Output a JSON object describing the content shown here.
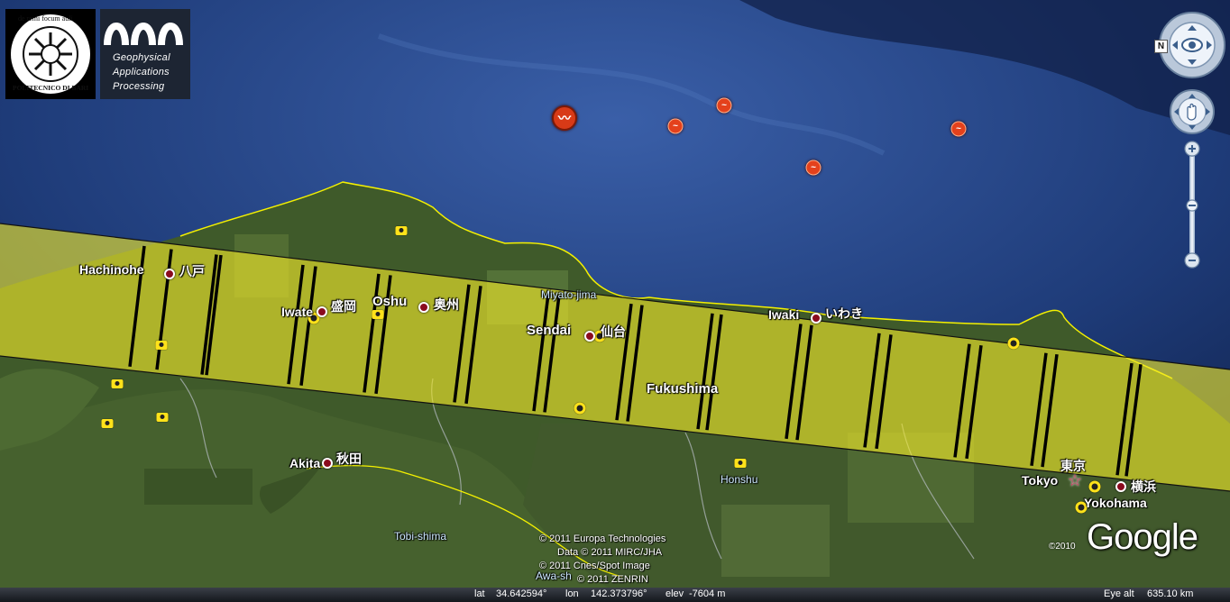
{
  "logos": {
    "poliba_top": "de remi focum auli",
    "poliba_bottom": "POLITECNICO DI BARI",
    "gap_line1": "Geophysical",
    "gap_line2": "Applications",
    "gap_line3": "Processing"
  },
  "cities": {
    "hachinohe": "Hachinohe",
    "hachinohe_jp": "八戸",
    "iwate": "Iwate",
    "morioka_jp": "盛岡",
    "oshu": "Oshu",
    "oshu_jp": "奥州",
    "sendai": "Sendai",
    "sendai_jp": "仙台",
    "iwaki": "Iwaki",
    "iwaki_jp": "いわき",
    "fukushima": "Fukushima",
    "akita": "Akita",
    "akita_jp": "秋田",
    "tokyo": "Tokyo",
    "tokyo_jp": "東京",
    "yokohama": "Yokohama",
    "yokohama_jp": "横浜"
  },
  "features": {
    "miyato_jima": "Miyato-jima",
    "honshu": "Honshu",
    "tobi_shima": "Tobi-shima",
    "awa_shima": "Awa-sh"
  },
  "copyright": {
    "line1": "© 2011 Europa Technologies",
    "line2": "Data © 2011 MIRC/JHA",
    "line3": "© 2011 Cnes/Spot Image",
    "line4": "© 2011 ZENRIN",
    "image_year": "©2010",
    "brand": "Google"
  },
  "status_bar": {
    "lat_label": "lat",
    "lat_value": "34.642594°",
    "lon_label": "lon",
    "lon_value": "142.373796°",
    "elev_label": "elev",
    "elev_value": "-7604 m",
    "eye_alt_label": "Eye alt",
    "eye_alt_value": "635.10 km"
  },
  "controls": {
    "north_label": "N"
  },
  "icons": {
    "quake": "earthquake-icon",
    "poi": "camera-icon",
    "city": "city-dot-icon",
    "capital": "capital-star-icon"
  },
  "colors": {
    "swath": "#f2ea2a",
    "coast": "#f4f000",
    "quake": "#e4411c",
    "ocean": "#1e3b78"
  }
}
